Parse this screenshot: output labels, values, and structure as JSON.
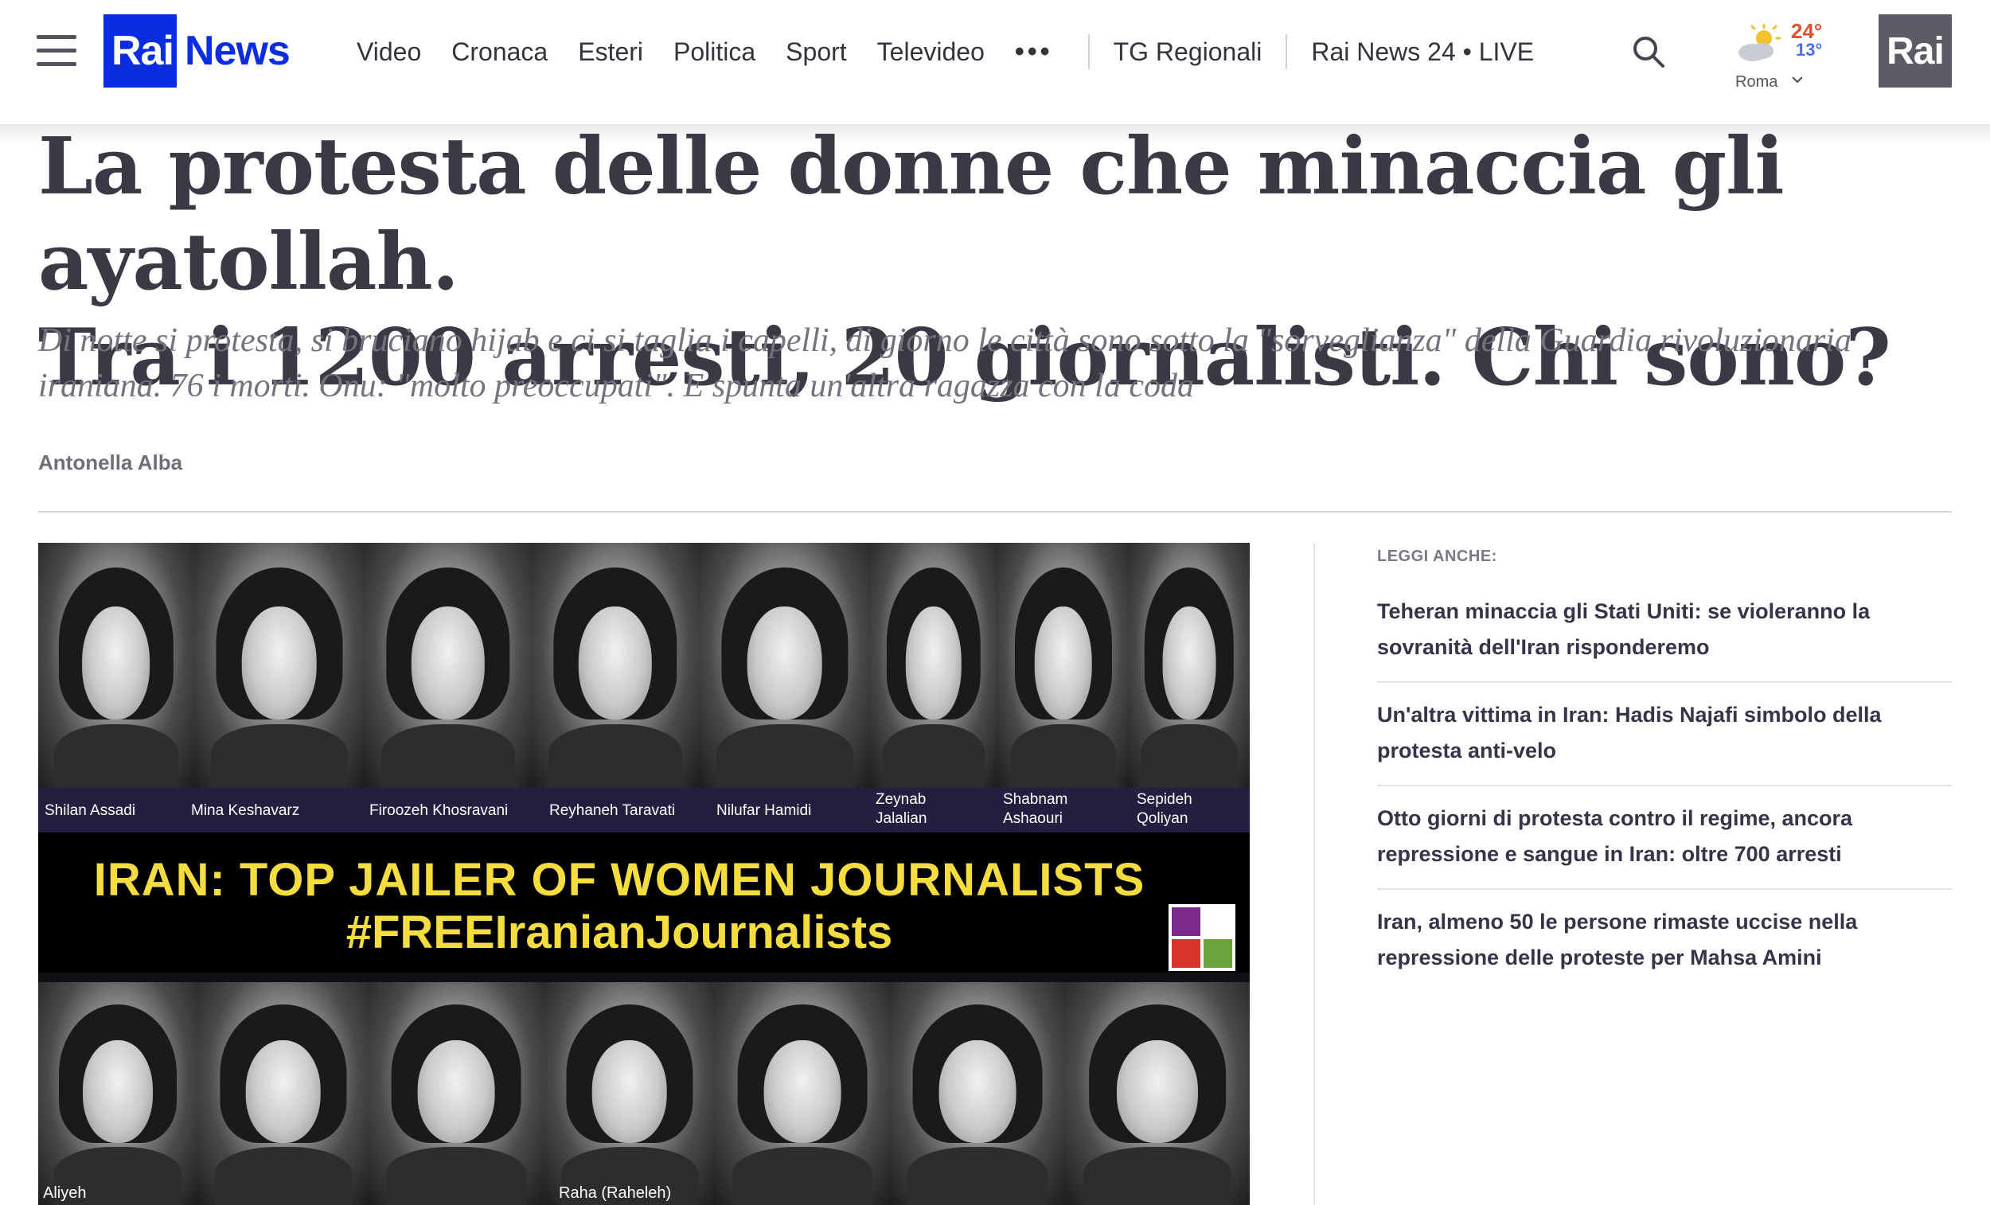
{
  "header": {
    "logo": {
      "rai": "Rai",
      "news": "News"
    },
    "nav": [
      "Video",
      "Cronaca",
      "Esteri",
      "Politica",
      "Sport",
      "Televideo"
    ],
    "more": "•••",
    "regional": "TG Regionali",
    "live": "Rai News 24 • LIVE",
    "weather": {
      "max": "24°",
      "min": "13°",
      "city": "Roma",
      "icon": "partly-cloudy-icon"
    },
    "portal": "Rai"
  },
  "article": {
    "title_line1": "La protesta delle donne che minaccia gli ayatollah.",
    "title_line2": "Tra i 1200 arresti, 20 giornalisti. Chi sono?",
    "subtitle": "Di notte si protesta, si bruciano hijab e ci si taglia i capelli, di giorno le città sono sotto la \"sorveglianza\" della Guardia rivoluzionaria iraniana. 76 i morti. Onu: \"molto preoccupati\". E spunta un'altra ragazza con la coda",
    "author": "Antonella Alba"
  },
  "hero_image": {
    "top_names": [
      [
        "Shilan Assadi"
      ],
      [
        "Mina Keshavarz"
      ],
      [
        "Firoozeh Khosravani"
      ],
      [
        "Reyhaneh Taravati"
      ],
      [
        "Nilufar Hamidi"
      ],
      [
        "Zeynab",
        "Jalalian"
      ],
      [
        "Shabnam",
        "Ashaouri"
      ],
      [
        "Sepideh",
        "Qoliyan"
      ]
    ],
    "banner_line1": "IRAN: TOP JAILER OF WOMEN JOURNALISTS",
    "banner_line2": "#FREEIranianJournalists",
    "bottom_names": [
      "Aliyeh",
      "Raha (Raheleh)"
    ]
  },
  "sidebar": {
    "title": "LEGGI ANCHE:",
    "items": [
      "Teheran minaccia gli Stati Uniti: se violeranno la sovranità dell'Iran risponderemo",
      "Un'altra vittima in Iran: Hadis Najafi simbolo della protesta anti-velo",
      "Otto giorni di protesta contro il regime, ancora repressione e sangue in Iran: oltre 700 arresti",
      "Iran, almeno 50 le persone rimaste uccise nella repressione delle proteste per Mahsa Amini"
    ]
  },
  "colors": {
    "brand_blue": "#0b2de0",
    "banner_yellow": "#f5dd3f",
    "temp_max": "#e2502c",
    "temp_min": "#4a6fe6"
  }
}
